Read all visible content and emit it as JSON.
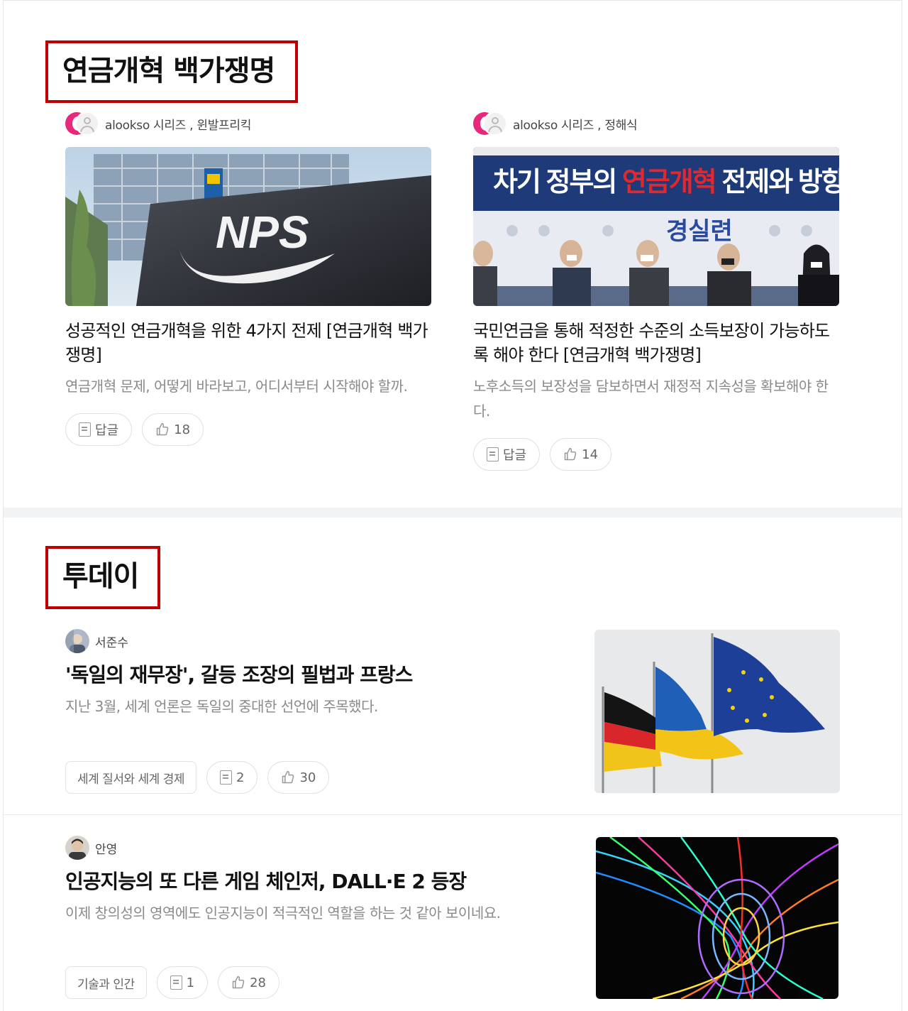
{
  "sections": [
    {
      "title": "연금개혁 백가쟁명",
      "cards": [
        {
          "author": "alookso 시리즈 , 윈발프리킥",
          "thumb_text": "NPS",
          "title": "성공적인 연금개혁을 위한 4가지 전제 [연금개혁 백가쟁명]",
          "subtitle": "연금개혁 문제, 어떻게 바라보고, 어디서부터 시작해야 할까.",
          "reply_label": "답글",
          "likes": "18"
        },
        {
          "author": "alookso 시리즈 , 정해식",
          "thumb_text": {
            "banner_prefix": "차기 정부의 ",
            "banner_highlight": "연금개혁",
            "banner_suffix": " 전제와 방향",
            "org": "경실련"
          },
          "title": "국민연금을 통해 적정한 수준의 소득보장이 가능하도록 해야 한다 [연금개혁 백가쟁명]",
          "subtitle": "노후소득의 보장성을 담보하면서 재정적 지속성을 확보해야 한다.",
          "reply_label": "답글",
          "likes": "14"
        }
      ]
    },
    {
      "title": "투데이",
      "rows": [
        {
          "author": "서준수",
          "title": "'독일의 재무장', 갈등 조장의 필법과 프랑스",
          "subtitle": "지난 3월, 세계 언론은 독일의 중대한 선언에 주목했다.",
          "tag": "세계 질서와 세계 경제",
          "replies": "2",
          "likes": "30"
        },
        {
          "author": "안영",
          "title": "인공지능의 또 다른 게임 체인저, DALL·E 2 등장",
          "subtitle": "이제 창의성의 영역에도 인공지능이 적극적인 역할을 하는 것 같아 보이네요.",
          "tag": "기술과 인간",
          "replies": "1",
          "likes": "28"
        }
      ]
    }
  ],
  "colors": {
    "highlight_border": "#c00000",
    "brand_pink": "#e8287a",
    "banner_red": "#e0282e",
    "banner_navy": "#1e3a78"
  },
  "icons": [
    "reply-icon",
    "like-icon",
    "user-avatar-icon"
  ]
}
